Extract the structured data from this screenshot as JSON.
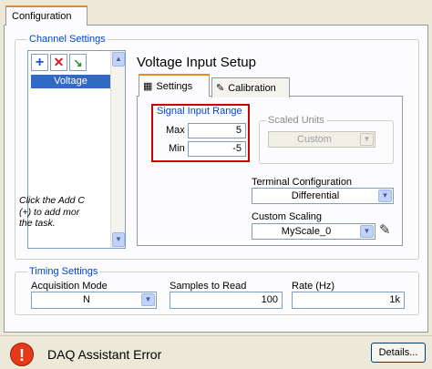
{
  "top_tab": "Configuration",
  "channel_settings": {
    "legend": "Channel Settings",
    "channels": [
      "Voltage"
    ],
    "note": "Click the Add C\n(+) to add mor\nthe task."
  },
  "setup_title": "Voltage Input Setup",
  "tabs": [
    "Settings",
    "Calibration"
  ],
  "signal_input_range": {
    "legend": "Signal Input Range",
    "max_label": "Max",
    "max_value": "5",
    "min_label": "Min",
    "min_value": "-5"
  },
  "scaled_units": {
    "legend": "Scaled Units",
    "value": "Custom"
  },
  "terminal_configuration": {
    "label": "Terminal Configuration",
    "value": "Differential"
  },
  "custom_scaling": {
    "label": "Custom Scaling",
    "value": "MyScale_0"
  },
  "timing_settings": {
    "legend": "Timing Settings",
    "acquisition_mode": {
      "label": "Acquisition Mode",
      "value": "N"
    },
    "samples_to_read": {
      "label": "Samples to Read",
      "value": "100"
    },
    "rate": {
      "label": "Rate (Hz)",
      "value": "1k"
    }
  },
  "error": {
    "title": "DAQ Assistant Error",
    "details_button": "Details..."
  }
}
